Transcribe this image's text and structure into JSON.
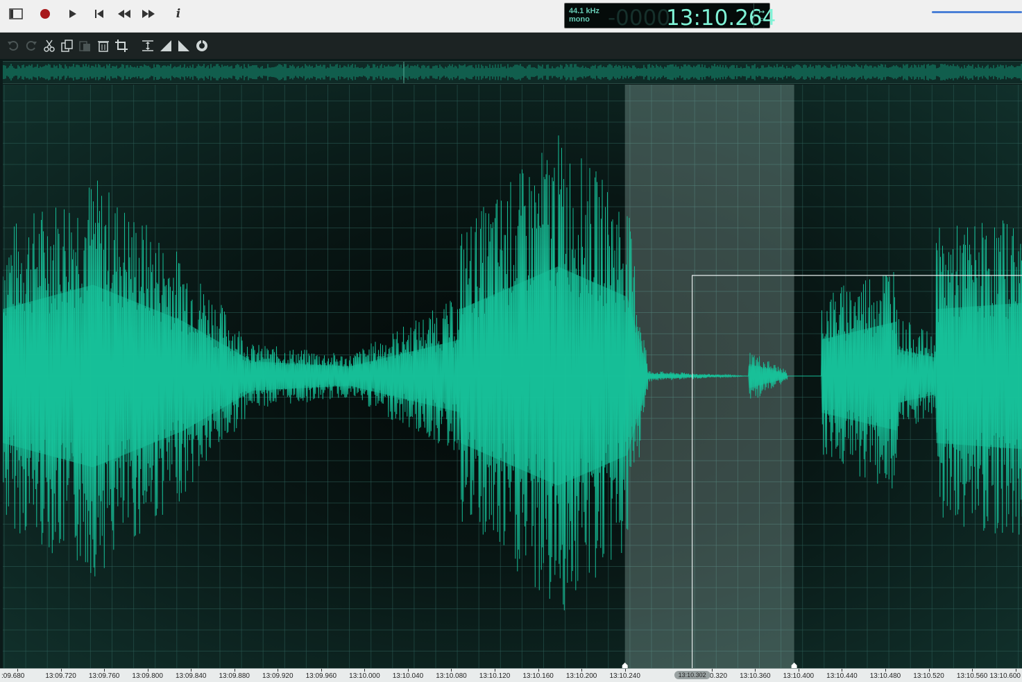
{
  "transport": {
    "buttons": [
      {
        "name": "toggle-panel-button",
        "icon": "panel-icon"
      },
      {
        "name": "record-button",
        "icon": "record-icon"
      },
      {
        "name": "play-button",
        "icon": "play-icon"
      },
      {
        "name": "skip-to-start-button",
        "icon": "skip-start-icon"
      },
      {
        "name": "rewind-button",
        "icon": "rewind-icon"
      },
      {
        "name": "fast-forward-button",
        "icon": "fast-forward-icon"
      },
      {
        "name": "info-button",
        "icon": "info-icon",
        "glyph": "i"
      }
    ]
  },
  "display": {
    "sample_rate": "44.1 kHz",
    "channels": "mono",
    "time_ghost": "-0000",
    "time": "13:10.264",
    "side_top": "↦",
    "side_bottom": "○"
  },
  "edit_toolbar": {
    "buttons": [
      {
        "name": "undo-button",
        "icon": "undo-icon"
      },
      {
        "name": "redo-button",
        "icon": "redo-icon"
      },
      {
        "name": "cut-button",
        "icon": "scissors-icon"
      },
      {
        "name": "copy-button",
        "icon": "copy-icon"
      },
      {
        "name": "paste-button",
        "icon": "paste-icon"
      },
      {
        "name": "delete-button",
        "icon": "trash-icon"
      },
      {
        "name": "crop-button",
        "icon": "crop-icon"
      },
      {
        "name": "normalize-button",
        "icon": "normalize-icon"
      },
      {
        "name": "fade-in-button",
        "icon": "fade-in-icon"
      },
      {
        "name": "fade-out-button",
        "icon": "fade-out-icon"
      },
      {
        "name": "effects-button",
        "icon": "effects-icon"
      }
    ]
  },
  "timeline": {
    "unit": "time",
    "view_start": "13:09.664",
    "view_end": "13:10.606",
    "ticks": [
      ":09.680",
      "13:09.720",
      "13:09.760",
      "13:09.800",
      "13:09.840",
      "13:09.880",
      "13:09.920",
      "13:09.960",
      "13:10.000",
      "13:10.040",
      "13:10.080",
      "13:10.120",
      "13:10.160",
      "13:10.200",
      "13:10.240",
      "13:10.320",
      "13:10.360",
      "13:10.400",
      "13:10.440",
      "13:10.480",
      "13:10.520",
      "13:10.560",
      "13:10.600"
    ],
    "cursor_label": "13:10.302",
    "selection_start": "13:10.240",
    "selection_end": "13:10.396"
  },
  "colors": {
    "waveform": "#17c39b",
    "selection": "#b7d6d2",
    "lcd_text": "#7ff3d6",
    "grid": "#2c5c55"
  }
}
